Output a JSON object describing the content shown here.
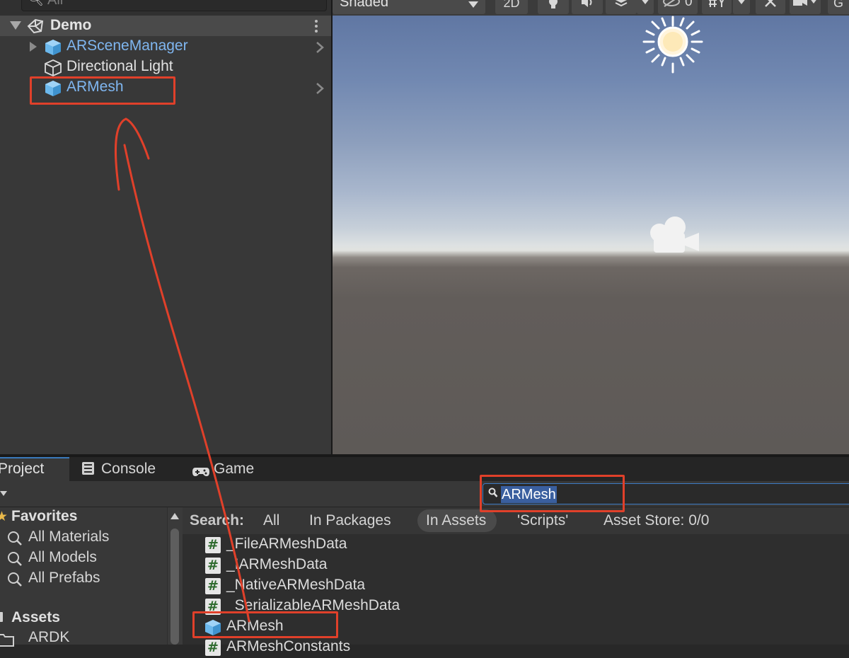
{
  "hierarchy": {
    "search_placeholder": "All",
    "scene_name": "Demo",
    "items": [
      {
        "label": "ARSceneManager",
        "kind": "prefab"
      },
      {
        "label": "Directional Light",
        "kind": "object"
      },
      {
        "label": "ARMesh",
        "kind": "prefab"
      }
    ]
  },
  "scene_toolbar": {
    "shading_mode": "Shaded",
    "mode_2d": "2D",
    "hidden_count": "0",
    "truncated_label": "G"
  },
  "tabs": [
    {
      "label": "Project"
    },
    {
      "label": "Console"
    },
    {
      "label": "Game"
    }
  ],
  "project": {
    "search_value": "ARMesh",
    "search_filter": {
      "label": "Search:",
      "options": [
        "All",
        "In Packages",
        "In Assets",
        "'Scripts'",
        "Asset Store: 0/0"
      ],
      "active": "In Assets"
    },
    "favorites": {
      "title": "Favorites",
      "items": [
        "All Materials",
        "All Models",
        "All Prefabs"
      ]
    },
    "assets": {
      "title": "Assets",
      "items": [
        "ARDK"
      ]
    },
    "results": [
      {
        "label": "_FileARMeshData",
        "kind": "script"
      },
      {
        "label": "_IARMeshData",
        "kind": "script"
      },
      {
        "label": "_NativeARMeshData",
        "kind": "script"
      },
      {
        "label": "_SerializableARMeshData",
        "kind": "script"
      },
      {
        "label": "ARMesh",
        "kind": "prefab"
      },
      {
        "label": "ARMeshConstants",
        "kind": "script"
      }
    ]
  },
  "colors": {
    "annotation_red": "#e0402a",
    "prefab_blue": "#7fb6f0",
    "selection_blue": "#3a5f9f"
  }
}
